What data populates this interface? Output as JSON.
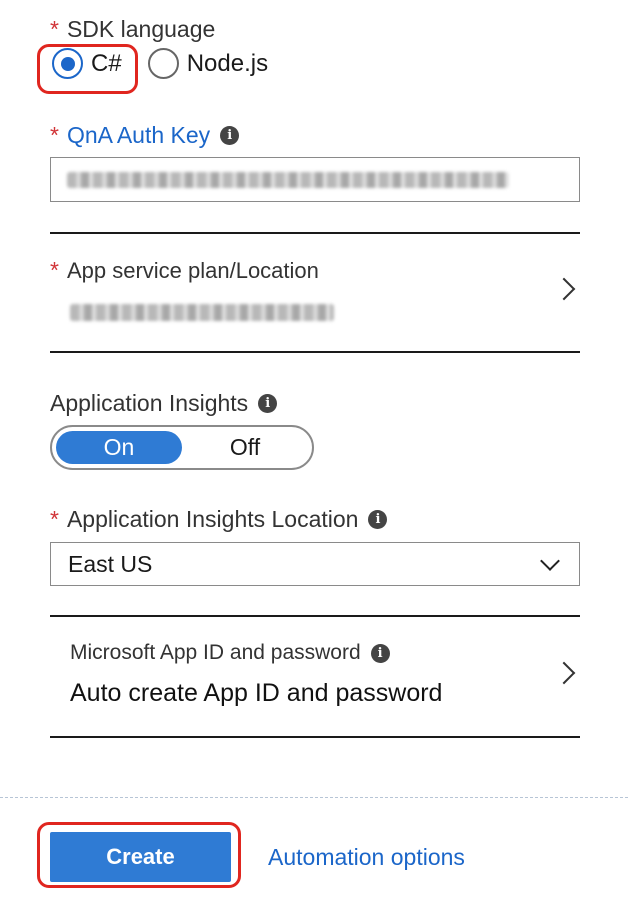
{
  "sdk_language": {
    "label": "SDK language",
    "options": [
      {
        "label": "C#",
        "selected": true
      },
      {
        "label": "Node.js",
        "selected": false
      }
    ]
  },
  "qna_auth_key": {
    "label": "QnA Auth Key",
    "value_blurred": true
  },
  "app_service_plan": {
    "label": "App service plan/Location",
    "value_blurred": true
  },
  "application_insights": {
    "label": "Application Insights",
    "on_label": "On",
    "off_label": "Off",
    "selected": "On"
  },
  "insights_location": {
    "label": "Application Insights Location",
    "value": "East US"
  },
  "app_id": {
    "label": "Microsoft App ID and password",
    "value": "Auto create App ID and password"
  },
  "footer": {
    "create_label": "Create",
    "automation_label": "Automation options"
  },
  "colors": {
    "accent": "#2f7bd4",
    "link": "#1b66c9",
    "required": "#d13438",
    "highlight": "#e0261f"
  },
  "icons": {
    "info": "info-icon",
    "chevron_right": "chevron-right-icon",
    "chevron_down": "chevron-down-icon"
  }
}
